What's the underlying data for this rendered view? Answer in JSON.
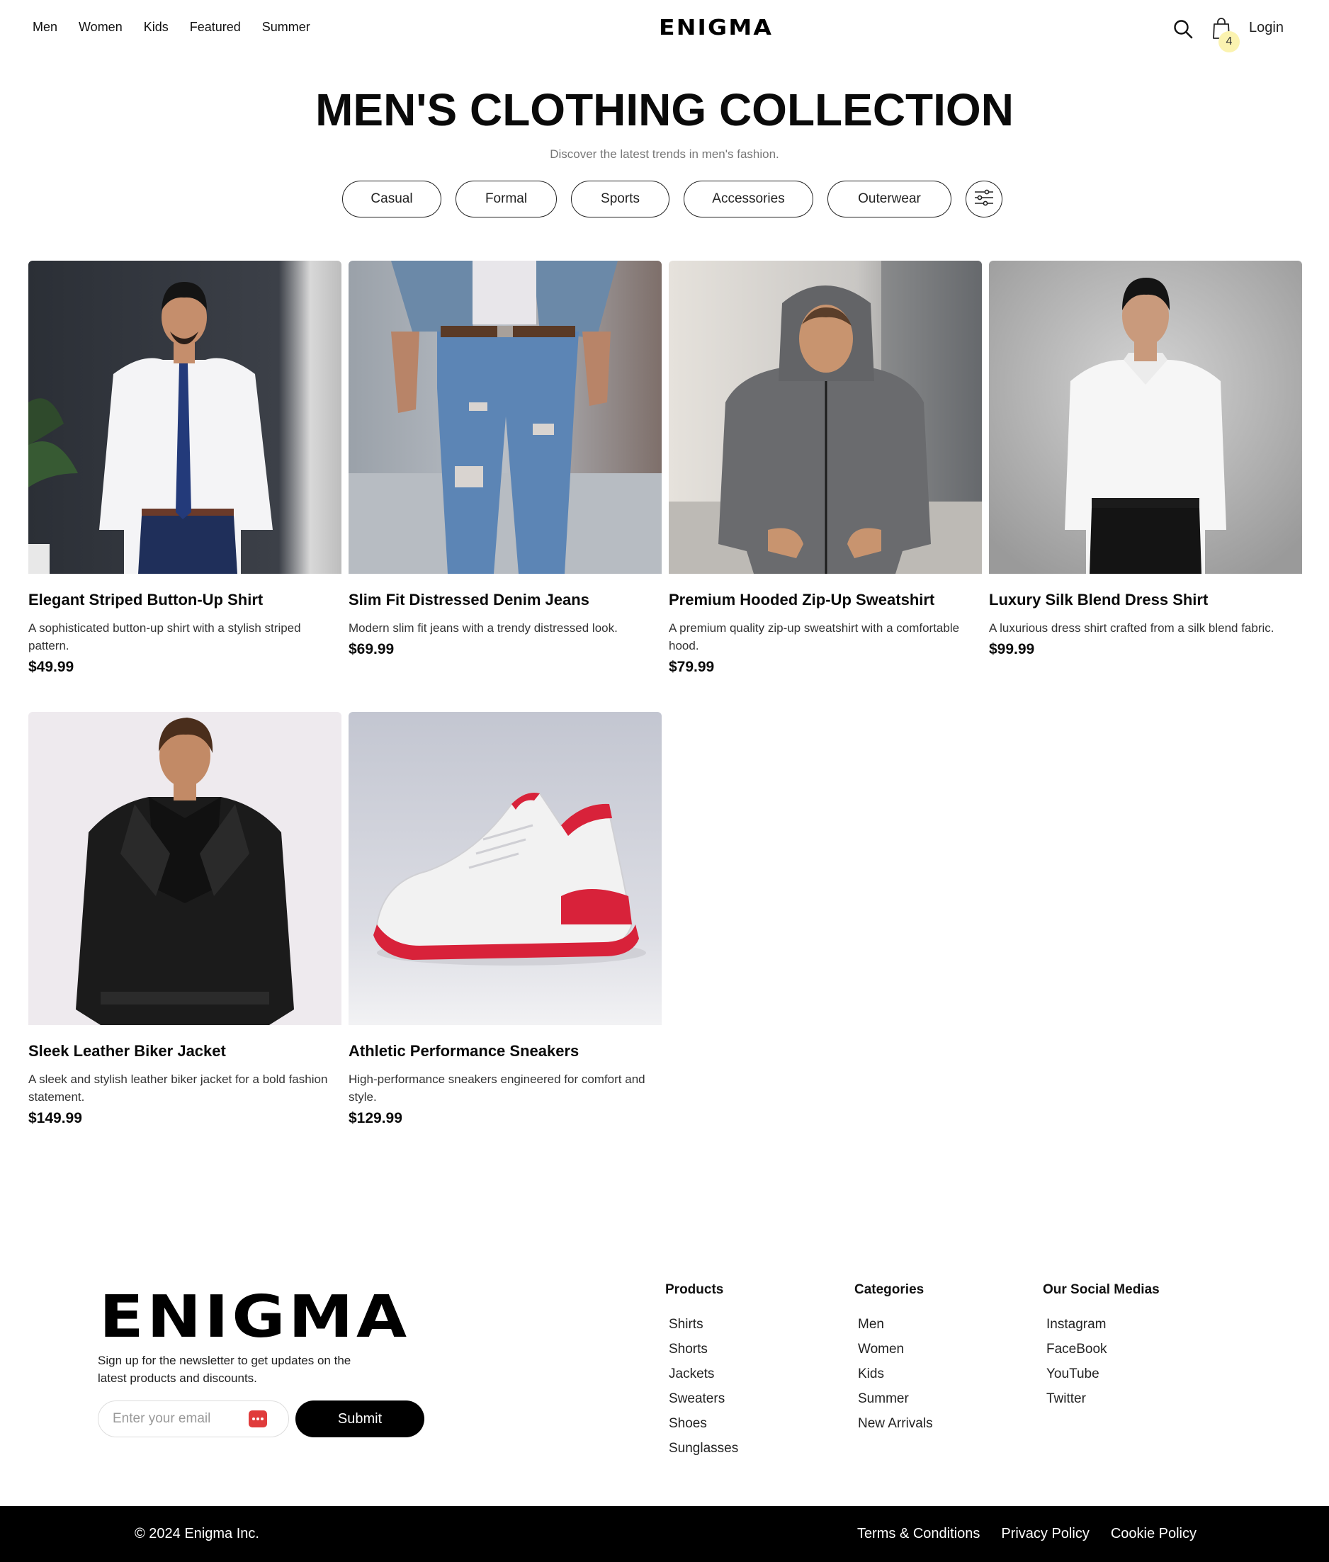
{
  "header": {
    "nav": [
      "Men",
      "Women",
      "Kids",
      "Featured",
      "Summer"
    ],
    "brand": "ENIGMA",
    "cart_count": "4",
    "login": "Login"
  },
  "hero": {
    "title": "MEN'S CLOTHING COLLECTION",
    "subtitle": "Discover the latest trends in men's fashion.",
    "filters": [
      "Casual",
      "Formal",
      "Sports",
      "Accessories",
      "Outerwear"
    ]
  },
  "products": [
    {
      "name": "Elegant Striped Button-Up Shirt",
      "description": "A sophisticated button-up shirt with a stylish striped pattern.",
      "price": "$49.99"
    },
    {
      "name": "Slim Fit Distressed Denim Jeans",
      "description": "Modern slim fit jeans with a trendy distressed look.",
      "price": "$69.99"
    },
    {
      "name": "Premium Hooded Zip-Up Sweatshirt",
      "description": "A premium quality zip-up sweatshirt with a comfortable hood.",
      "price": "$79.99"
    },
    {
      "name": "Luxury Silk Blend Dress Shirt",
      "description": "A luxurious dress shirt crafted from a silk blend fabric.",
      "price": "$99.99"
    },
    {
      "name": "Sleek Leather Biker Jacket",
      "description": "A sleek and stylish leather biker jacket for a bold fashion statement.",
      "price": "$149.99"
    },
    {
      "name": "Athletic Performance Sneakers",
      "description": "High-performance sneakers engineered for comfort and style.",
      "price": "$129.99"
    }
  ],
  "footer": {
    "brand": "ENIGMA",
    "newsletter_text": "Sign up for the newsletter to get updates on the latest products and discounts.",
    "email_placeholder": "Enter your email",
    "submit_label": "Submit",
    "columns": [
      {
        "title": "Products",
        "links": [
          "Shirts",
          "Shorts",
          "Jackets",
          "Sweaters",
          "Shoes",
          "Sunglasses"
        ]
      },
      {
        "title": "Categories",
        "links": [
          "Men",
          "Women",
          "Kids",
          "Summer",
          "New Arrivals"
        ]
      },
      {
        "title": "Our Social Medias",
        "links": [
          "Instagram",
          "FaceBook",
          "YouTube",
          "Twitter"
        ]
      }
    ],
    "copyright": "© 2024 Enigma Inc.",
    "legal": [
      "Terms & Conditions",
      "Privacy Policy",
      "Cookie Policy"
    ]
  },
  "colors": {
    "accent_black": "#000000",
    "cart_badge": "#fbf3b0",
    "password_icon": "#e03c3c"
  }
}
